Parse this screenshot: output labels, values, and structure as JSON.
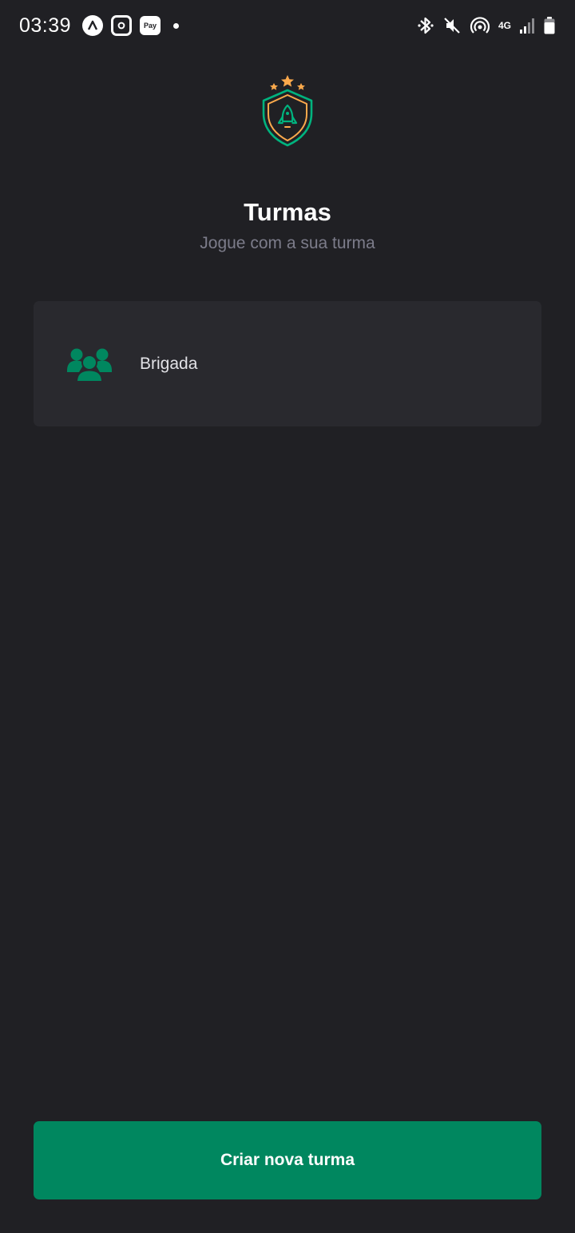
{
  "status_bar": {
    "time": "03:39",
    "app_icons": [
      "letter-a-app-icon",
      "instagram-icon",
      "pay-icon"
    ],
    "pay_label": "Pay",
    "network": "4G"
  },
  "header": {
    "logo_icon": "rocket-shield-logo",
    "title": "Turmas",
    "subtitle": "Jogue com a sua turma"
  },
  "classes": [
    {
      "name": "Brigada",
      "icon": "users-group-icon"
    }
  ],
  "actions": {
    "create_label": "Criar nova turma"
  },
  "colors": {
    "background": "#202024",
    "card": "#29292e",
    "accent": "#00875f",
    "star": "#fba94c",
    "subtitle": "#7c7c8a"
  }
}
